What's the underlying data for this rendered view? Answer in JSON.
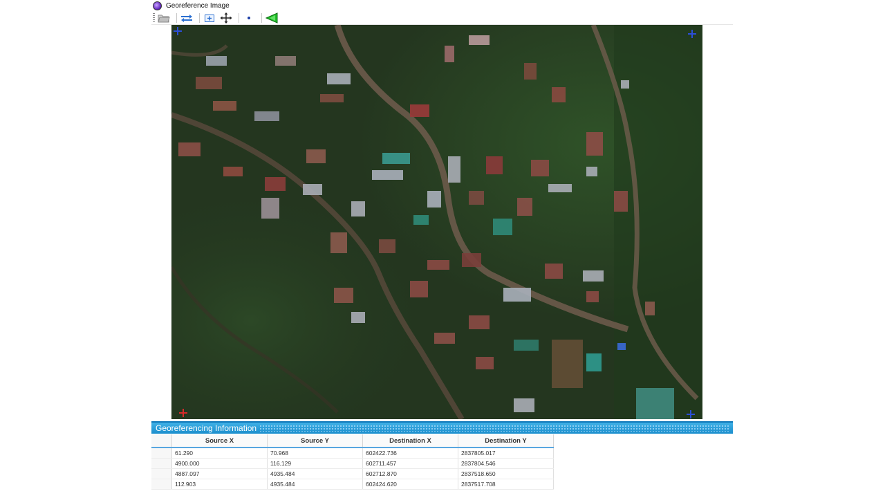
{
  "window": {
    "title": "Georeference Image"
  },
  "toolbar": {
    "buttons": [
      {
        "name": "open-image",
        "icon": "folder-icon"
      },
      {
        "name": "rotate",
        "icon": "rotate-arrows-icon"
      },
      {
        "name": "zoom-extent",
        "icon": "zoom-extent-icon"
      },
      {
        "name": "pan",
        "icon": "pan-arrows-icon"
      },
      {
        "name": "add-point",
        "icon": "add-point-icon"
      },
      {
        "name": "apply",
        "icon": "green-arrow-icon"
      }
    ]
  },
  "map": {
    "content": "aerial photograph of hillside village with roads and houses"
  },
  "info_panel": {
    "title": "Georeferencing Information",
    "columns": [
      "Source X",
      "Source Y",
      "Destination X",
      "Destination Y"
    ],
    "rows": [
      [
        "61.290",
        "70.968",
        "602422.736",
        "2837805.017"
      ],
      [
        "4900.000",
        "116.129",
        "602711.457",
        "2837804.546"
      ],
      [
        "4887.097",
        "4935.484",
        "602712.870",
        "2837518.650"
      ],
      [
        "112.903",
        "4935.484",
        "602424.620",
        "2837517.708"
      ]
    ]
  },
  "colors": {
    "header_blue": "#1c8fcd",
    "marker_blue": "#2b4fd8",
    "marker_red": "#d82b2b"
  }
}
